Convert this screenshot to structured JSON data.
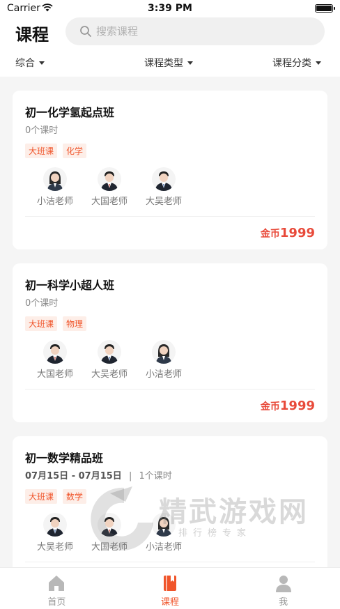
{
  "status_bar": {
    "carrier": "Carrier",
    "time": "3:39 PM"
  },
  "header": {
    "title": "课程"
  },
  "search": {
    "placeholder": "搜索课程"
  },
  "filters": [
    {
      "label": "综合"
    },
    {
      "label": "课程类型"
    },
    {
      "label": "课程分类"
    }
  ],
  "courses": [
    {
      "title": "初一化学氢起点班",
      "lessons": "0个课时",
      "tags": [
        "大班课",
        "化学"
      ],
      "teachers": [
        {
          "name": "小洁老师",
          "avatar": "female-teacher-avatar"
        },
        {
          "name": "大国老师",
          "avatar": "male-teacher-avatar"
        },
        {
          "name": "大吴老师",
          "avatar": "male-teacher-avatar"
        }
      ],
      "price_prefix": "金币",
      "price": "1999"
    },
    {
      "title": "初一科学小超人班",
      "lessons": "0个课时",
      "tags": [
        "大班课",
        "物理"
      ],
      "teachers": [
        {
          "name": "大国老师",
          "avatar": "male-teacher-avatar"
        },
        {
          "name": "大吴老师",
          "avatar": "male-teacher-avatar"
        },
        {
          "name": "小洁老师",
          "avatar": "female-teacher-avatar"
        }
      ],
      "price_prefix": "金币",
      "price": "1999"
    },
    {
      "title": "初一数学精品班",
      "dates": "07月15日 - 07月15日",
      "separator": "|",
      "lessons": "1个课时",
      "tags": [
        "大班课",
        "数学"
      ],
      "teachers": [
        {
          "name": "大吴老师",
          "avatar": "male-teacher-avatar"
        },
        {
          "name": "大国老师",
          "avatar": "male-teacher-avatar"
        },
        {
          "name": "小洁老师",
          "avatar": "female-teacher-avatar"
        }
      ]
    }
  ],
  "watermark": {
    "title": "精武游戏网",
    "subtitle": "排行榜专家"
  },
  "tabbar": [
    {
      "label": "首页",
      "icon": "home-icon",
      "active": false
    },
    {
      "label": "课程",
      "icon": "course-book-icon",
      "active": true
    },
    {
      "label": "我",
      "icon": "profile-icon",
      "active": false
    }
  ],
  "colors": {
    "accent": "#f0552b",
    "price": "#e84a3a",
    "tag_bg": "#fdeee8",
    "page_bg": "#f5f5f5"
  }
}
